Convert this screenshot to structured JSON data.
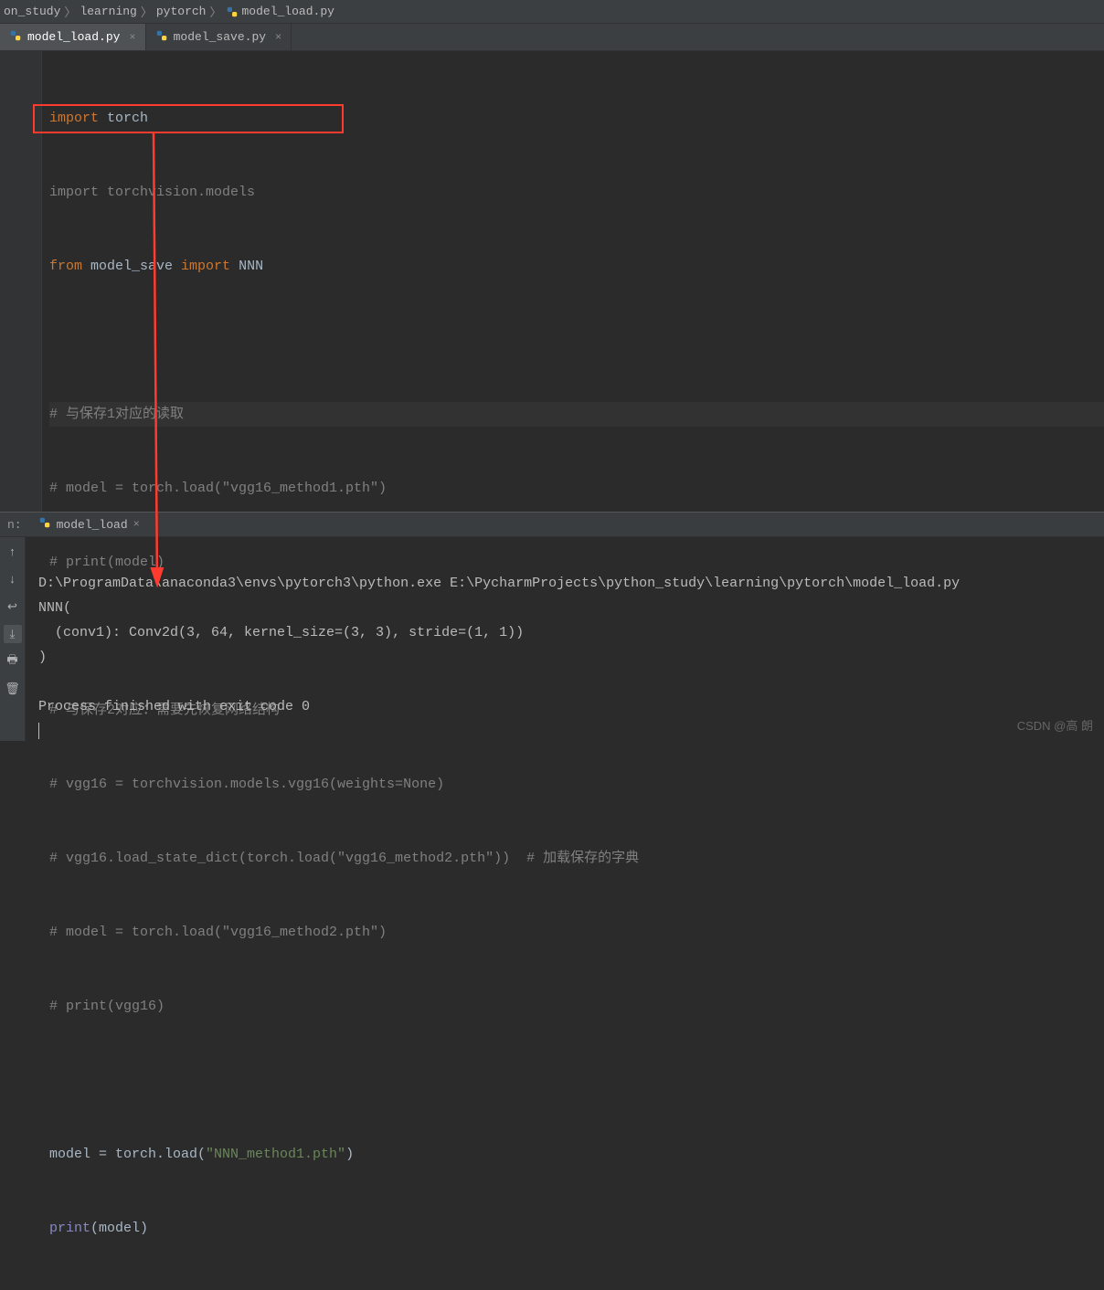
{
  "breadcrumb": {
    "items": [
      "on_study",
      "learning",
      "pytorch",
      "model_load.py"
    ]
  },
  "tabs": [
    {
      "label": "model_load.py",
      "active": true
    },
    {
      "label": "model_save.py",
      "active": false
    }
  ],
  "code": {
    "l1_kw": "import",
    "l1_rest": " torch",
    "l2": "import torchvision.models",
    "l3_kw1": "from",
    "l3_mid": " model_save ",
    "l3_kw2": "import",
    "l3_rest": " NNN",
    "l5": "# 与保存1对应的读取",
    "l6": "# model = torch.load(\"vgg16_method1.pth\")",
    "l7": "# print(model)",
    "l9": "# 与保存2对应：需要先恢复网络结构",
    "l10": "# vgg16 = torchvision.models.vgg16(weights=None)",
    "l11": "# vgg16.load_state_dict(torch.load(\"vgg16_method2.pth\"))  # 加载保存的字典",
    "l12": "# model = torch.load(\"vgg16_method2.pth\")",
    "l13": "# print(vgg16)",
    "l15a": "model = torch.load(",
    "l15b": "\"NNN_method1.pth\"",
    "l15c": ")",
    "l16a": "print",
    "l16b": "(model)"
  },
  "run": {
    "label": "n:",
    "config": "model_load"
  },
  "console": {
    "l1": "D:\\ProgramData\\anaconda3\\envs\\pytorch3\\python.exe E:\\PycharmProjects\\python_study\\learning\\pytorch\\model_load.py",
    "l2": "NNN(",
    "l3": "  (conv1): Conv2d(3, 64, kernel_size=(3, 3), stride=(1, 1))",
    "l4": ")",
    "l5": "",
    "l6": "Process finished with exit code 0"
  },
  "watermark": "CSDN @高 朗",
  "icons": {
    "close": "×",
    "sep": "〉"
  },
  "tools": [
    "arrow-up",
    "arrow-down",
    "wrap",
    "scroll-end",
    "print",
    "trash"
  ]
}
